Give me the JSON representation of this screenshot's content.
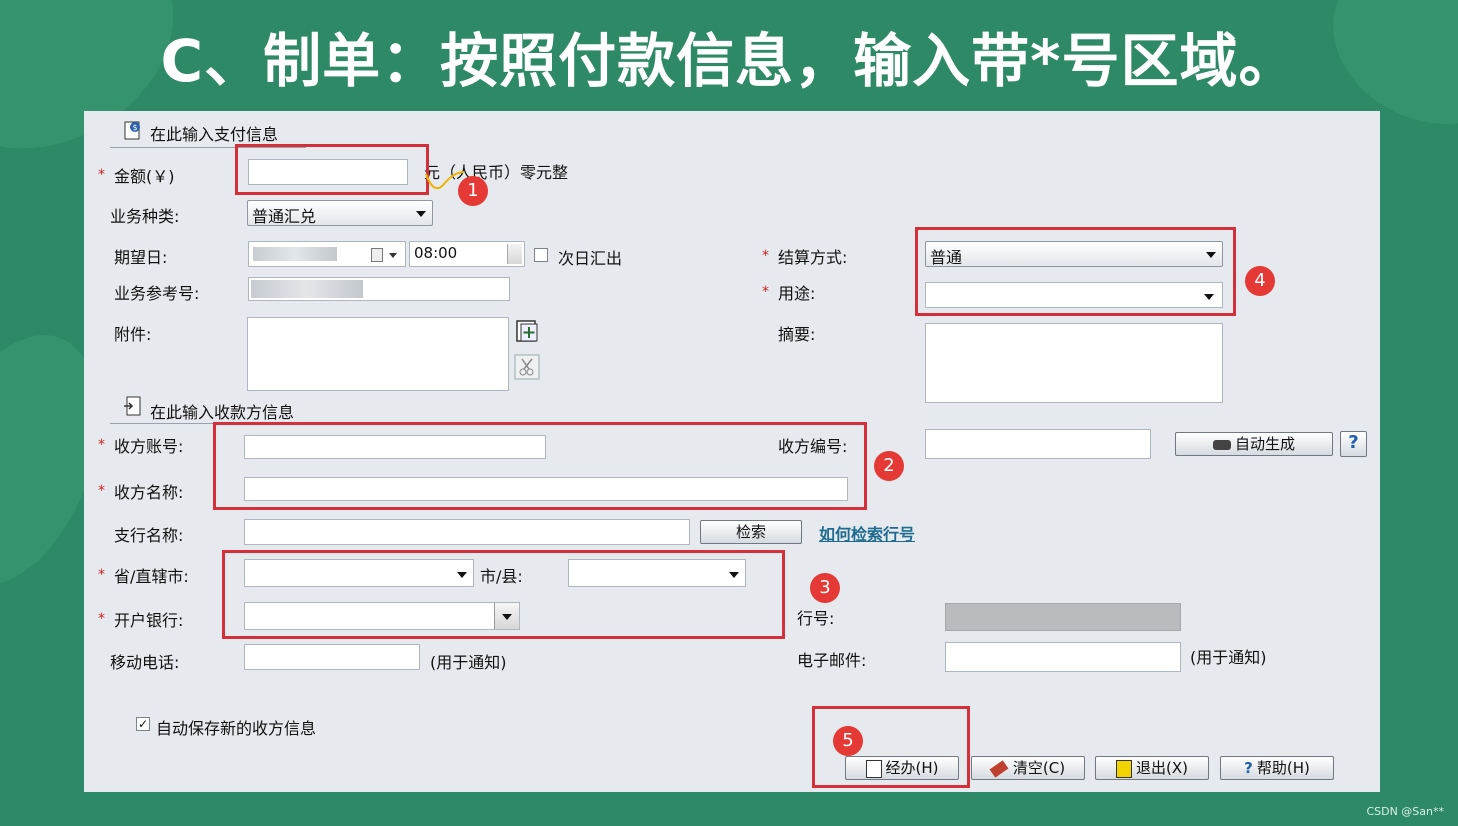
{
  "slide": {
    "title": "C、制单：按照付款信息，输入带*号区域。"
  },
  "payment_section": {
    "title": "在此输入支付信息"
  },
  "amount": {
    "label": "金额(￥)",
    "value": "",
    "in_words": "元（人民币）零元整"
  },
  "business_type": {
    "label": "业务种类:",
    "selected": "普通汇兑"
  },
  "expected_date": {
    "label": "期望日:",
    "time": "08:00",
    "next_day_label": "次日汇出"
  },
  "business_ref": {
    "label": "业务参考号:"
  },
  "attachment": {
    "label": "附件:"
  },
  "settlement": {
    "label": "结算方式:",
    "selected": "普通"
  },
  "purpose": {
    "label": "用途:",
    "selected": ""
  },
  "summary": {
    "label": "摘要:"
  },
  "payee_section": {
    "title": "在此输入收款方信息"
  },
  "payee_account": {
    "label": "收方账号:"
  },
  "payee_name": {
    "label": "收方名称:"
  },
  "payee_code": {
    "label": "收方编号:"
  },
  "auto_generate_label": "自动生成",
  "help_glyph": "?",
  "branch_name": {
    "label": "支行名称:",
    "search_label": "检索",
    "how_to_link": "如何检索行号"
  },
  "province": {
    "label": "省/直辖市:"
  },
  "city": {
    "label": "市/县:"
  },
  "bank": {
    "label": "开户银行:"
  },
  "bank_no": {
    "label": "行号:"
  },
  "mobile": {
    "label": "移动电话:",
    "note": "(用于通知)"
  },
  "email": {
    "label": "电子邮件:",
    "note": "(用于通知)"
  },
  "auto_save": {
    "label": "自动保存新的收方信息",
    "checked": true
  },
  "actions": {
    "handle": "经办(H)",
    "clear": "清空(C)",
    "exit": "退出(X)",
    "help": "帮助(H)"
  },
  "badges": [
    "1",
    "2",
    "3",
    "4",
    "5"
  ],
  "required_mark": "*",
  "watermark": "CSDN @San**",
  "colors": {
    "annotation_red": "#d3303a",
    "badge_red": "#e53935",
    "background_green": "#2e8a66"
  }
}
